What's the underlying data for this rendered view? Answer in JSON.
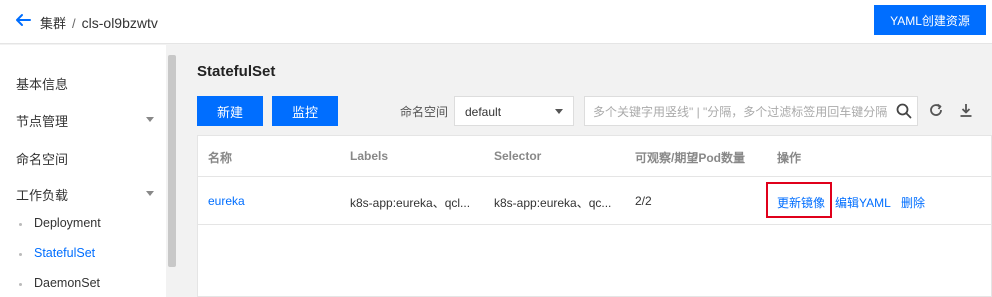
{
  "header": {
    "breadcrumb_root": "集群",
    "breadcrumb_sep": "/",
    "breadcrumb_current": "cls-ol9bzwtv",
    "yaml_button": "YAML创建资源"
  },
  "sidebar": {
    "items": [
      {
        "label": "基本信息"
      },
      {
        "label": "节点管理"
      },
      {
        "label": "命名空间"
      },
      {
        "label": "工作负载"
      }
    ],
    "sub_items": [
      {
        "label": "Deployment"
      },
      {
        "label": "StatefulSet"
      },
      {
        "label": "DaemonSet"
      }
    ]
  },
  "main": {
    "title": "StatefulSet",
    "create_button": "新建",
    "monitor_button": "监控",
    "namespace_label": "命名空间",
    "namespace_value": "default",
    "search_placeholder": "多个关键字用竖线\" | \"分隔，多个过滤标签用回车键分隔"
  },
  "table": {
    "columns": [
      "名称",
      "Labels",
      "Selector",
      "可观察/期望Pod数量",
      "操作"
    ],
    "rows": [
      {
        "name": "eureka",
        "labels": "k8s-app:eureka、qcl...",
        "selector": "k8s-app:eureka、qc...",
        "pods": "2/2",
        "actions": [
          "更新镜像",
          "编辑YAML",
          "删除"
        ]
      }
    ]
  },
  "colors": {
    "primary": "#006eff",
    "highlight_border": "#e0001b"
  }
}
